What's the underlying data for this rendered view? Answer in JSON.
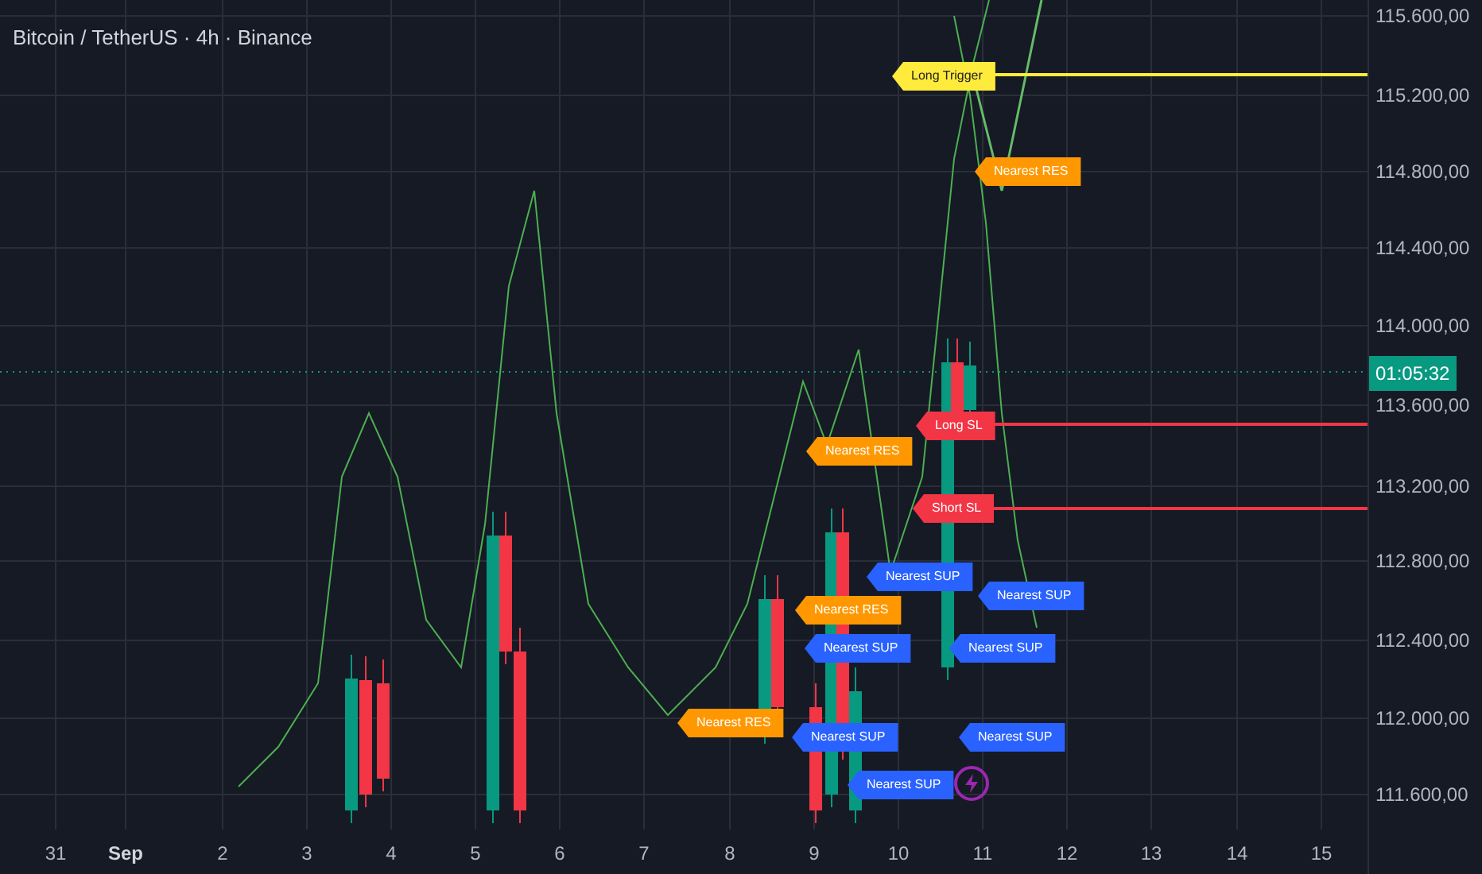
{
  "title": "Bitcoin / TetherUS · 4h · Binance",
  "levels": [
    {
      "kind": "trigger",
      "text": "Long Trigger"
    },
    {
      "kind": "resistance",
      "text": "Nearest RES"
    },
    {
      "kind": "stop",
      "text": "Long SL"
    },
    {
      "kind": "resistance",
      "text": "Nearest RES"
    },
    {
      "kind": "stop",
      "text": "Short SL"
    },
    {
      "kind": "support",
      "text": "Nearest SUP"
    },
    {
      "kind": "support",
      "text": "Nearest SUP"
    },
    {
      "kind": "resistance",
      "text": "Nearest RES"
    },
    {
      "kind": "support",
      "text": "Nearest SUP"
    },
    {
      "kind": "support",
      "text": "Nearest SUP"
    },
    {
      "kind": "resistance",
      "text": "Nearest RES"
    },
    {
      "kind": "support",
      "text": "Nearest SUP"
    },
    {
      "kind": "support",
      "text": "Nearest SUP"
    },
    {
      "kind": "support",
      "text": "Nearest SUP"
    }
  ],
  "price_axis": [
    "115.600,00",
    "115.200,00",
    "114.800,00",
    "114.400,00",
    "114.000,00",
    "113.600,00",
    "113.200,00",
    "112.800,00",
    "112.400,00",
    "112.000,00",
    "111.600,00"
  ],
  "countdown": "01:05:32",
  "time_axis": [
    {
      "label": "31",
      "emphasized": false
    },
    {
      "label": "Sep",
      "emphasized": true
    },
    {
      "label": "2",
      "emphasized": false
    },
    {
      "label": "3",
      "emphasized": false
    },
    {
      "label": "4",
      "emphasized": false
    },
    {
      "label": "5",
      "emphasized": false
    },
    {
      "label": "6",
      "emphasized": false
    },
    {
      "label": "7",
      "emphasized": false
    },
    {
      "label": "8",
      "emphasized": false
    },
    {
      "label": "9",
      "emphasized": false
    },
    {
      "label": "10",
      "emphasized": false
    },
    {
      "label": "11",
      "emphasized": false
    },
    {
      "label": "12",
      "emphasized": false
    },
    {
      "label": "13",
      "emphasized": false
    },
    {
      "label": "14",
      "emphasized": false
    },
    {
      "label": "15",
      "emphasized": false
    }
  ]
}
